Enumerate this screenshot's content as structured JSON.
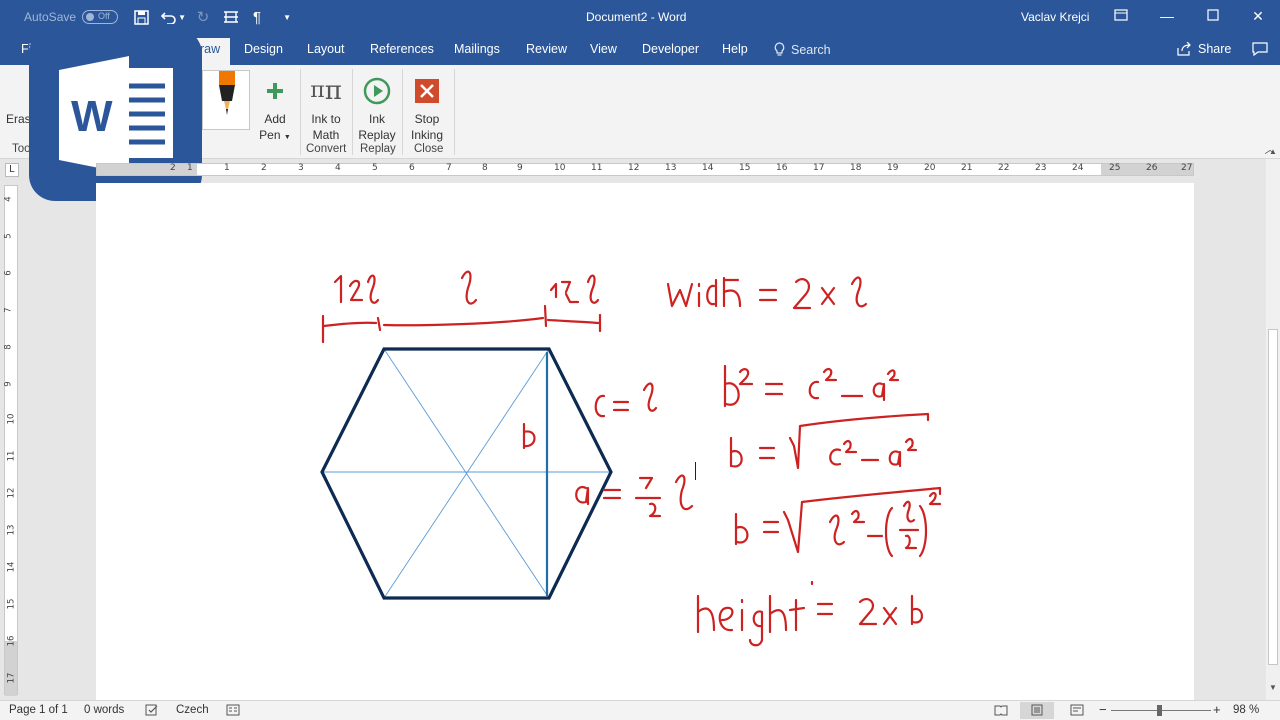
{
  "title_bar": {
    "autosave_label": "AutoSave",
    "autosave_state": "Off",
    "document_title": "Document2 - Word",
    "user_name": "Vaclav Krejci"
  },
  "tabs": [
    {
      "label": "File"
    },
    {
      "label": "Draw"
    },
    {
      "label": "Design"
    },
    {
      "label": "Layout"
    },
    {
      "label": "References"
    },
    {
      "label": "Mailings"
    },
    {
      "label": "Review"
    },
    {
      "label": "View"
    },
    {
      "label": "Developer"
    },
    {
      "label": "Help"
    }
  ],
  "tab_partials": {
    "file": "Fi",
    "draw": "raw"
  },
  "search_label": "Search",
  "share_label": "Share",
  "ribbon": {
    "eraser_partial": "Erase",
    "tools_partial": "Too",
    "add_pen": {
      "line1": "Add",
      "line2": "Pen"
    },
    "ink_to_math": {
      "line1": "Ink to",
      "line2": "Math"
    },
    "ink_replay": {
      "line1": "Ink",
      "line2": "Replay"
    },
    "stop_inking": {
      "line1": "Stop",
      "line2": "Inking"
    },
    "group_labels": {
      "convert": "Convert",
      "replay": "Replay",
      "close": "Close"
    }
  },
  "ruler": {
    "h_numbers": [
      "2",
      "1",
      "1",
      "2",
      "3",
      "4",
      "5",
      "6",
      "7",
      "8",
      "9",
      "10",
      "11",
      "12",
      "13",
      "14",
      "15",
      "16",
      "17",
      "18",
      "19",
      "20",
      "21",
      "22",
      "23",
      "24",
      "25",
      "26",
      "27"
    ],
    "v_numbers": [
      "4",
      "5",
      "6",
      "7",
      "8",
      "9",
      "10",
      "11",
      "12",
      "13",
      "14",
      "15",
      "16",
      "17"
    ]
  },
  "status": {
    "page": "Page 1 of 1",
    "words": "0 words",
    "language": "Czech",
    "zoom": "98 %"
  },
  "colors": {
    "word_blue": "#2b579a",
    "ink_red": "#cc2222",
    "hexagon": "#0d2a52"
  }
}
